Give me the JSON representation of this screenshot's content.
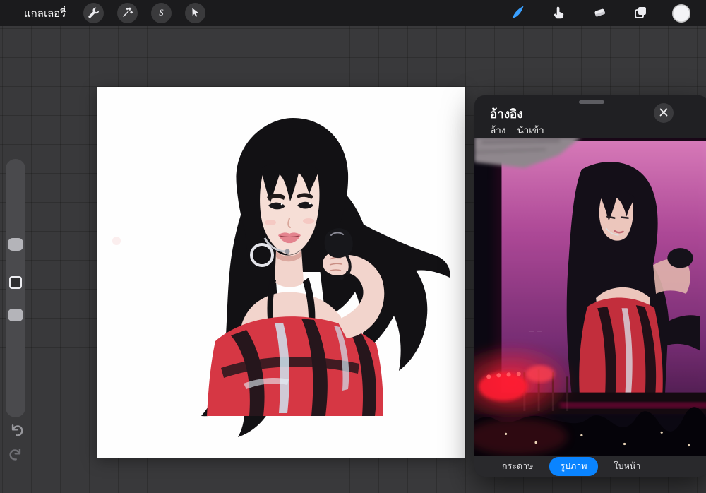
{
  "topbar": {
    "gallery_label": "แกลเลอรี่",
    "selection_glyph": "S",
    "left_tools": [
      {
        "id": "actions",
        "icon": "wrench-icon"
      },
      {
        "id": "adjustments",
        "icon": "magic-wand-icon"
      },
      {
        "id": "selection",
        "icon": "selection-s-icon"
      },
      {
        "id": "transform",
        "icon": "transform-arrow-icon"
      }
    ],
    "right_tools": [
      {
        "id": "paint",
        "icon": "brush-icon",
        "active": true
      },
      {
        "id": "smudge",
        "icon": "smudge-finger-icon",
        "active": false
      },
      {
        "id": "erase",
        "icon": "eraser-icon",
        "active": false
      },
      {
        "id": "layers",
        "icon": "layers-icon",
        "active": false
      },
      {
        "id": "color",
        "icon": "color-disc-icon",
        "current_color": "#f4f4f6"
      }
    ]
  },
  "left_sidebar": {
    "controls": [
      {
        "id": "brush-size-slider",
        "type": "slider"
      },
      {
        "id": "modify-button",
        "type": "button"
      },
      {
        "id": "brush-opacity-slider",
        "type": "slider"
      },
      {
        "id": "undo-button",
        "icon": "undo-arrow-icon"
      },
      {
        "id": "redo-button",
        "icon": "redo-arrow-icon"
      }
    ]
  },
  "canvas": {
    "background": "#ffffff",
    "content": "digital illustration: woman with long black hair, hoop earring, headset mic, red top with black and light-blue streaks, arm extended holding dark mic"
  },
  "reference_panel": {
    "title": "อ้างอิง",
    "clear_label": "ล้าง",
    "import_label": "นำเข้า",
    "close_icon": "x-icon",
    "content": "concert reference photo: performer on pink/purple stage screen, red stage lights, crowd silhouette",
    "tabs": [
      {
        "label": "กระดาษ",
        "active": false
      },
      {
        "label": "รูปภาพ",
        "active": true
      },
      {
        "label": "ใบหน้า",
        "active": false
      }
    ],
    "active_tab_color": "#0a84ff"
  },
  "colors": {
    "topbar_bg": "#1b1b1d",
    "workspace_bg": "#39393b",
    "panel_bg": "#202023",
    "accent_blue": "#0a84ff",
    "brush_selected": "#3aa0ff"
  }
}
